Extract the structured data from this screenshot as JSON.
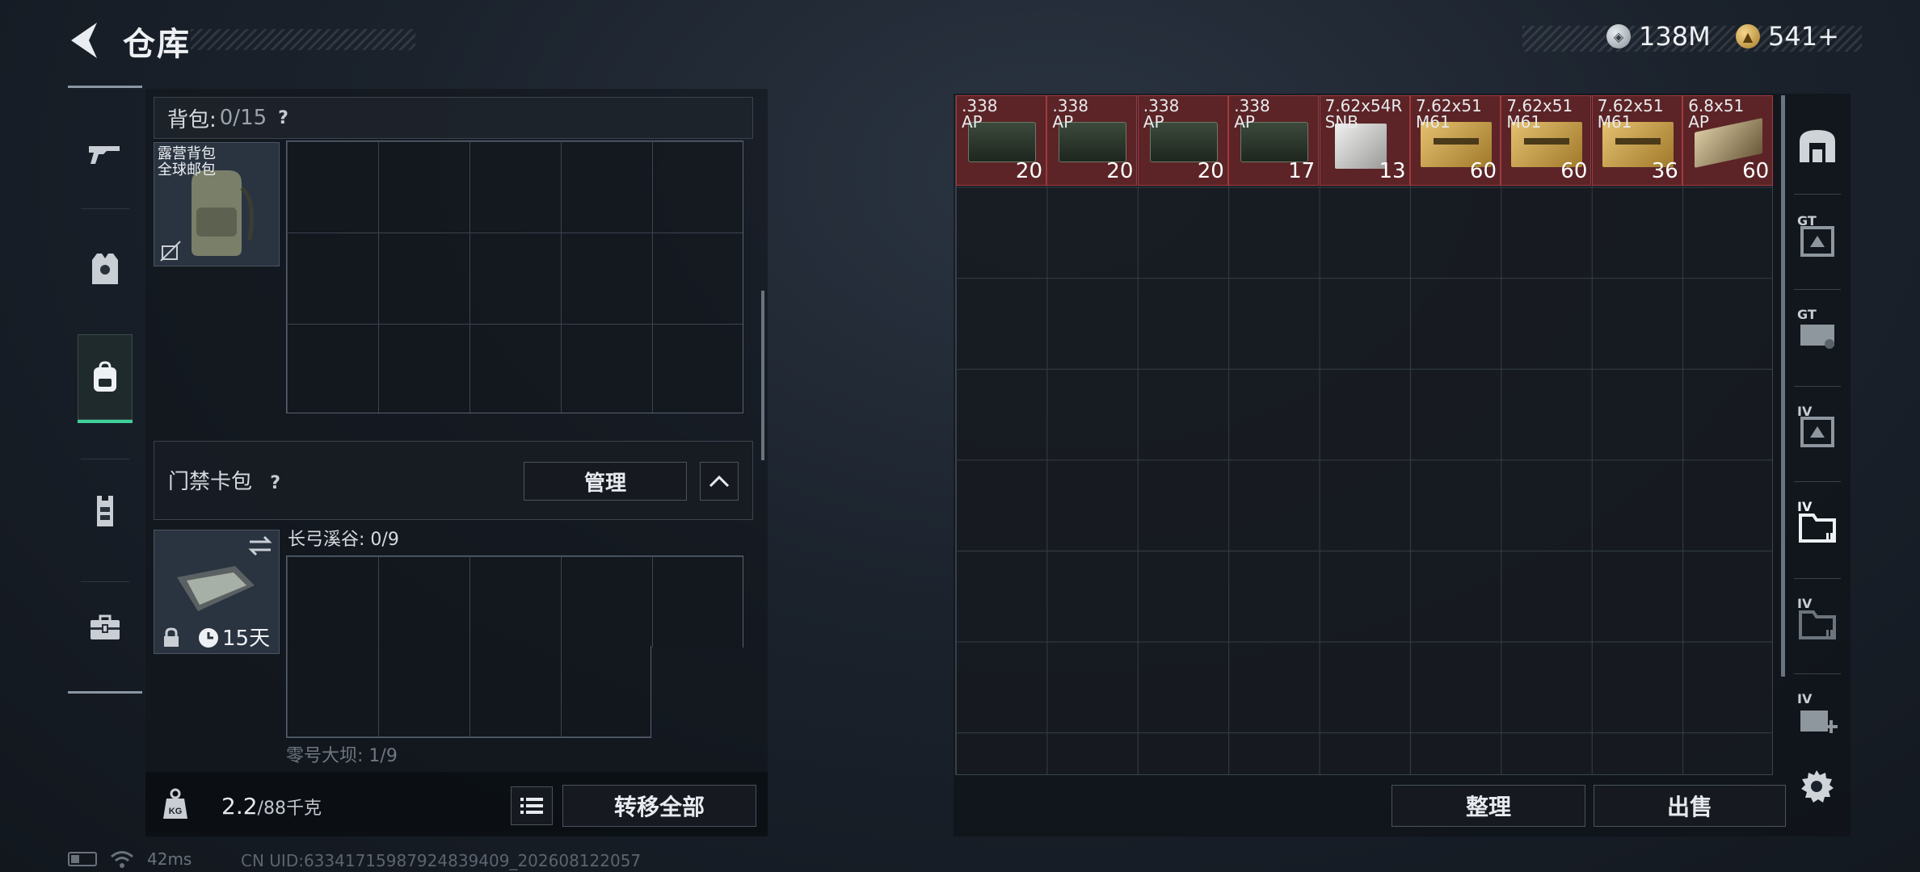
{
  "header": {
    "title": "仓库",
    "currencies": [
      {
        "icon": "silver-coin-icon",
        "value": "138M"
      },
      {
        "icon": "gold-coin-icon",
        "value": "541+"
      }
    ]
  },
  "left_nav": {
    "items": [
      {
        "icon": "gun-icon",
        "active": false
      },
      {
        "icon": "armor-vest-icon",
        "active": false
      },
      {
        "icon": "backpack-icon",
        "active": true
      },
      {
        "icon": "chest-rig-icon",
        "active": false
      },
      {
        "icon": "toolbox-icon",
        "active": false
      }
    ]
  },
  "backpack": {
    "label": "背包:",
    "count": "0/15",
    "help": "?",
    "item_name": "露营背包\n全球邮包"
  },
  "keycard": {
    "label": "门禁卡包",
    "help": "?",
    "manage_label": "管理",
    "timer": "15天",
    "slot1_label": "长弓溪谷: 0/9",
    "slot2_label": "零号大坝: 1/9"
  },
  "bottom_left": {
    "weight_main": "2.2",
    "weight_rest": "/88千克",
    "transfer_label": "转移全部"
  },
  "storage": {
    "ammo": [
      {
        "name": ".338\nAP",
        "qty": "20",
        "box": "green"
      },
      {
        "name": ".338\nAP",
        "qty": "20",
        "box": "green"
      },
      {
        "name": ".338\nAP",
        "qty": "20",
        "box": "green"
      },
      {
        "name": ".338\nAP",
        "qty": "17",
        "box": "green"
      },
      {
        "name": "7.62x54R\nSNB",
        "qty": "13",
        "box": "white"
      },
      {
        "name": "7.62x51\nM61",
        "qty": "60",
        "box": "tan"
      },
      {
        "name": "7.62x51\nM61",
        "qty": "60",
        "box": "tan"
      },
      {
        "name": "7.62x51\nM61",
        "qty": "36",
        "box": "tan"
      },
      {
        "name": "6.8x51\nAP",
        "qty": "60",
        "box": "dark"
      }
    ],
    "sort_label": "整理",
    "sell_label": "出售"
  },
  "right_tabs": [
    {
      "icon": "main-storage-icon",
      "level": ""
    },
    {
      "icon": "storage-expansion-icon",
      "level": "GT"
    },
    {
      "icon": "storage-expansion-icon",
      "level": "GT"
    },
    {
      "icon": "storage-expansion-icon",
      "level": "IV"
    },
    {
      "icon": "folder-storage-icon",
      "level": "IV"
    },
    {
      "icon": "folder-storage-icon",
      "level": "IV"
    },
    {
      "icon": "add-storage-icon",
      "level": "IV"
    }
  ],
  "status_bar": {
    "ping": "42ms",
    "uid": "CN UID:63341715987924839409_202608122057"
  },
  "colors": {
    "accent_active": "#3fcf9a",
    "ammo_highlight": "#5c2427"
  }
}
